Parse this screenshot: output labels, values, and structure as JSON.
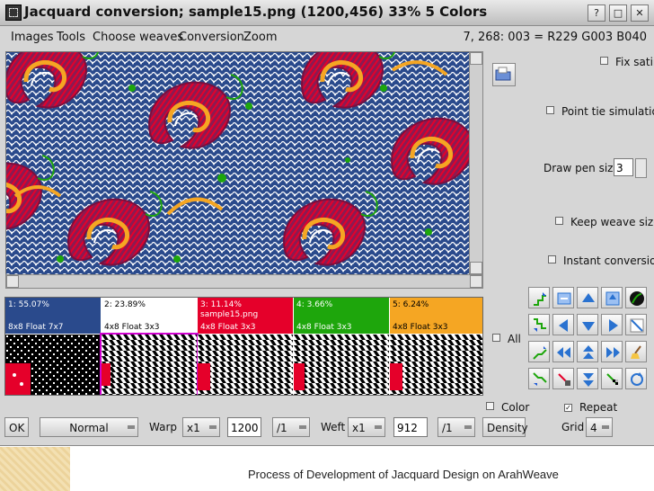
{
  "window": {
    "title": "Jacquard conversion; sample15.png (1200,456) 33% 5 Colors",
    "controls": [
      "?",
      "□",
      "✕"
    ]
  },
  "menu": [
    "Images",
    "Tools",
    "Choose weaves",
    "Conversion",
    "Zoom"
  ],
  "status_readout": "7, 268: 003 = R229 G003 B040",
  "palette": [
    {
      "pct": "1: 55.07%",
      "name": "",
      "weave": "8x8 Float 7x7",
      "color": "#2a4a8c",
      "text_color": "#ffffff"
    },
    {
      "pct": "2: 23.89%",
      "name": "",
      "weave": "4x8 Float 3x3",
      "color": "#ffffff",
      "text_color": "#000000"
    },
    {
      "pct": "3: 11.14%",
      "name": "sample15.png",
      "weave": "4x8 Float 3x3",
      "color": "#e5002a",
      "text_color": "#ffffff"
    },
    {
      "pct": "4: 3.66%",
      "name": "",
      "weave": "4x8 Float 3x3",
      "color": "#1ea60c",
      "text_color": "#ffffff"
    },
    {
      "pct": "5: 6.24%",
      "name": "",
      "weave": "4x8 Float 3x3",
      "color": "#f5a623",
      "text_color": "#000000"
    }
  ],
  "options": {
    "fix_satin": "Fix satin",
    "point_tie": "Point tie simulation",
    "draw_pen_label": "Draw pen size",
    "draw_pen_value": "3",
    "keep_weave_size": "Keep weave size",
    "instant_conversion": "Instant conversion",
    "all": "All",
    "color": "Color",
    "repeat": "Repeat"
  },
  "bottom": {
    "ok": "OK",
    "mode": "Normal",
    "warp_label": "Warp",
    "warp_mult": "x1",
    "warp_value": "1200",
    "warp_div": "/1",
    "weft_label": "Weft",
    "weft_mult": "x1",
    "weft_value": "912",
    "weft_div": "/1",
    "density": "Density",
    "grid_label": "Grid",
    "grid_value": "4"
  },
  "caption": "Process of Development of Jacquard Design on ArahWeave",
  "colors": {
    "pattern_bg": "#2a4a8c",
    "accent": "#2a72d0"
  }
}
